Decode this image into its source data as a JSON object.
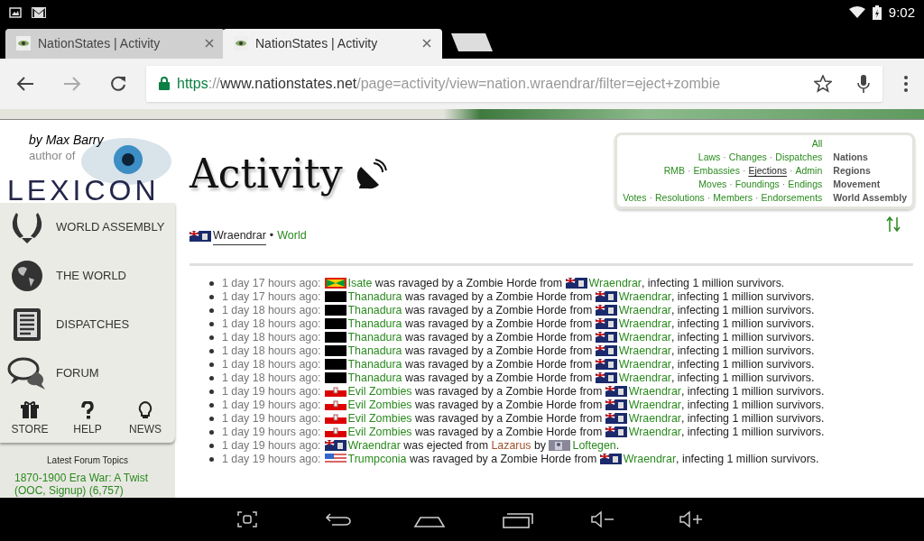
{
  "status_bar": {
    "time": "9:02"
  },
  "tabs": [
    {
      "title": "NationStates | Activity",
      "selected": false
    },
    {
      "title": "NationStates | Activity",
      "selected": true
    }
  ],
  "address_bar": {
    "scheme": "https",
    "separator": "://",
    "host": "www.nationstates.net",
    "path": "/page=activity/view=nation.wraendrar/filter=eject+zombie"
  },
  "sidebar": {
    "byline": "by Max Barry",
    "author_of": "author of",
    "book": "LEXICON",
    "menu": [
      {
        "label": "WORLD ASSEMBLY",
        "kind": "wa"
      },
      {
        "label": "THE WORLD",
        "kind": "globe"
      },
      {
        "label": "DISPATCHES",
        "kind": "dispatch"
      },
      {
        "label": "FORUM",
        "kind": "forum"
      }
    ],
    "small_menu": [
      {
        "label": "STORE",
        "kind": "gift"
      },
      {
        "label": "HELP",
        "kind": "help"
      },
      {
        "label": "NEWS",
        "kind": "bulb"
      }
    ],
    "forum_heading": "Latest Forum Topics",
    "forum_topic": "1870-1900 Era War: A Twist (OOC, Signup) (6,757)"
  },
  "page": {
    "title": "Activity",
    "breadcrumb_separator": "•",
    "breadcrumb": [
      {
        "text": "Wraendrar",
        "selected": true
      },
      {
        "text": "World",
        "selected": false
      }
    ]
  },
  "filters": {
    "separator": "·",
    "all": {
      "text": "All",
      "selected": false
    },
    "rows": [
      {
        "category": "Nations",
        "links": [
          {
            "text": "Laws",
            "selected": false
          },
          {
            "text": "Changes",
            "selected": false
          },
          {
            "text": "Dispatches",
            "selected": false
          }
        ]
      },
      {
        "category": "Regions",
        "links": [
          {
            "text": "RMB",
            "selected": false
          },
          {
            "text": "Embassies",
            "selected": false
          },
          {
            "text": "Ejections",
            "selected": true
          },
          {
            "text": "Admin",
            "selected": false
          }
        ]
      },
      {
        "category": "Movement",
        "links": [
          {
            "text": "Moves",
            "selected": false
          },
          {
            "text": "Foundings",
            "selected": false
          },
          {
            "text": "Endings",
            "selected": false
          }
        ]
      },
      {
        "category": "World Assembly",
        "links": [
          {
            "text": "Votes",
            "selected": false
          },
          {
            "text": "Resolutions",
            "selected": false
          },
          {
            "text": "Members",
            "selected": false
          },
          {
            "text": "Endorsements",
            "selected": false
          }
        ]
      }
    ]
  },
  "events": [
    {
      "time": "1 day 17 hours ago:",
      "parts": [
        {
          "kind": "grenada_flag"
        },
        {
          "kind": "nation",
          "text": "Isate"
        },
        {
          "kind": "text",
          "text": " was ravaged by a Zombie Horde from "
        },
        {
          "kind": "cayman_flag"
        },
        {
          "kind": "nation",
          "text": "Wraendrar"
        },
        {
          "kind": "text",
          "text": ", infecting 1 million survivors."
        }
      ]
    },
    {
      "time": "1 day 17 hours ago:",
      "parts": [
        {
          "kind": "black_flag"
        },
        {
          "kind": "nation",
          "text": "Thanadura"
        },
        {
          "kind": "text",
          "text": " was ravaged by a Zombie Horde from "
        },
        {
          "kind": "cayman_flag"
        },
        {
          "kind": "nation",
          "text": "Wraendrar"
        },
        {
          "kind": "text",
          "text": ", infecting 1 million survivors."
        }
      ]
    },
    {
      "time": "1 day 18 hours ago:",
      "parts": [
        {
          "kind": "black_flag"
        },
        {
          "kind": "nation",
          "text": "Thanadura"
        },
        {
          "kind": "text",
          "text": " was ravaged by a Zombie Horde from "
        },
        {
          "kind": "cayman_flag"
        },
        {
          "kind": "nation",
          "text": "Wraendrar"
        },
        {
          "kind": "text",
          "text": ", infecting 1 million survivors."
        }
      ]
    },
    {
      "time": "1 day 18 hours ago:",
      "parts": [
        {
          "kind": "black_flag"
        },
        {
          "kind": "nation",
          "text": "Thanadura"
        },
        {
          "kind": "text",
          "text": " was ravaged by a Zombie Horde from "
        },
        {
          "kind": "cayman_flag"
        },
        {
          "kind": "nation",
          "text": "Wraendrar"
        },
        {
          "kind": "text",
          "text": ", infecting 1 million survivors."
        }
      ]
    },
    {
      "time": "1 day 18 hours ago:",
      "parts": [
        {
          "kind": "black_flag"
        },
        {
          "kind": "nation",
          "text": "Thanadura"
        },
        {
          "kind": "text",
          "text": " was ravaged by a Zombie Horde from "
        },
        {
          "kind": "cayman_flag"
        },
        {
          "kind": "nation",
          "text": "Wraendrar"
        },
        {
          "kind": "text",
          "text": ", infecting 1 million survivors."
        }
      ]
    },
    {
      "time": "1 day 18 hours ago:",
      "parts": [
        {
          "kind": "black_flag"
        },
        {
          "kind": "nation",
          "text": "Thanadura"
        },
        {
          "kind": "text",
          "text": " was ravaged by a Zombie Horde from "
        },
        {
          "kind": "cayman_flag"
        },
        {
          "kind": "nation",
          "text": "Wraendrar"
        },
        {
          "kind": "text",
          "text": ", infecting 1 million survivors."
        }
      ]
    },
    {
      "time": "1 day 18 hours ago:",
      "parts": [
        {
          "kind": "black_flag"
        },
        {
          "kind": "nation",
          "text": "Thanadura"
        },
        {
          "kind": "text",
          "text": " was ravaged by a Zombie Horde from "
        },
        {
          "kind": "cayman_flag"
        },
        {
          "kind": "nation",
          "text": "Wraendrar"
        },
        {
          "kind": "text",
          "text": ", infecting 1 million survivors."
        }
      ]
    },
    {
      "time": "1 day 18 hours ago:",
      "parts": [
        {
          "kind": "black_flag"
        },
        {
          "kind": "nation",
          "text": "Thanadura"
        },
        {
          "kind": "text",
          "text": " was ravaged by a Zombie Horde from "
        },
        {
          "kind": "cayman_flag"
        },
        {
          "kind": "nation",
          "text": "Wraendrar"
        },
        {
          "kind": "text",
          "text": ", infecting 1 million survivors."
        }
      ]
    },
    {
      "time": "1 day 19 hours ago:",
      "parts": [
        {
          "kind": "redwhite_flag"
        },
        {
          "kind": "nation",
          "text": "Evil Zombies"
        },
        {
          "kind": "text",
          "text": " was ravaged by a Zombie Horde from "
        },
        {
          "kind": "cayman_flag"
        },
        {
          "kind": "nation",
          "text": "Wraendrar"
        },
        {
          "kind": "text",
          "text": ", infecting 1 million survivors."
        }
      ]
    },
    {
      "time": "1 day 19 hours ago:",
      "parts": [
        {
          "kind": "redwhite_flag"
        },
        {
          "kind": "nation",
          "text": "Evil Zombies"
        },
        {
          "kind": "text",
          "text": " was ravaged by a Zombie Horde from "
        },
        {
          "kind": "cayman_flag"
        },
        {
          "kind": "nation",
          "text": "Wraendrar"
        },
        {
          "kind": "text",
          "text": ", infecting 1 million survivors."
        }
      ]
    },
    {
      "time": "1 day 19 hours ago:",
      "parts": [
        {
          "kind": "redwhite_flag"
        },
        {
          "kind": "nation",
          "text": "Evil Zombies"
        },
        {
          "kind": "text",
          "text": " was ravaged by a Zombie Horde from "
        },
        {
          "kind": "cayman_flag"
        },
        {
          "kind": "nation",
          "text": "Wraendrar"
        },
        {
          "kind": "text",
          "text": ", infecting 1 million survivors."
        }
      ]
    },
    {
      "time": "1 day 19 hours ago:",
      "parts": [
        {
          "kind": "redwhite_flag"
        },
        {
          "kind": "nation",
          "text": "Evil Zombies"
        },
        {
          "kind": "text",
          "text": " was ravaged by a Zombie Horde from "
        },
        {
          "kind": "cayman_flag"
        },
        {
          "kind": "nation",
          "text": "Wraendrar"
        },
        {
          "kind": "text",
          "text": ", infecting 1 million survivors."
        }
      ]
    },
    {
      "time": "1 day 19 hours ago:",
      "parts": [
        {
          "kind": "cayman_flag"
        },
        {
          "kind": "nation",
          "text": "Wraendrar"
        },
        {
          "kind": "text",
          "text": " was ejected from "
        },
        {
          "kind": "region",
          "text": "Lazarus"
        },
        {
          "kind": "text",
          "text": " by "
        },
        {
          "kind": "grey_flag"
        },
        {
          "kind": "nation",
          "text": "Loftegen"
        },
        {
          "kind": "text",
          "text": "."
        }
      ]
    },
    {
      "time": "1 day 19 hours ago:",
      "parts": [
        {
          "kind": "us_flag"
        },
        {
          "kind": "nation",
          "text": "Trumpconia"
        },
        {
          "kind": "text",
          "text": " was ravaged by a Zombie Horde from "
        },
        {
          "kind": "cayman_flag"
        },
        {
          "kind": "nation",
          "text": "Wraendrar"
        },
        {
          "kind": "text",
          "text": ", infecting 1 million survivors."
        }
      ]
    }
  ]
}
